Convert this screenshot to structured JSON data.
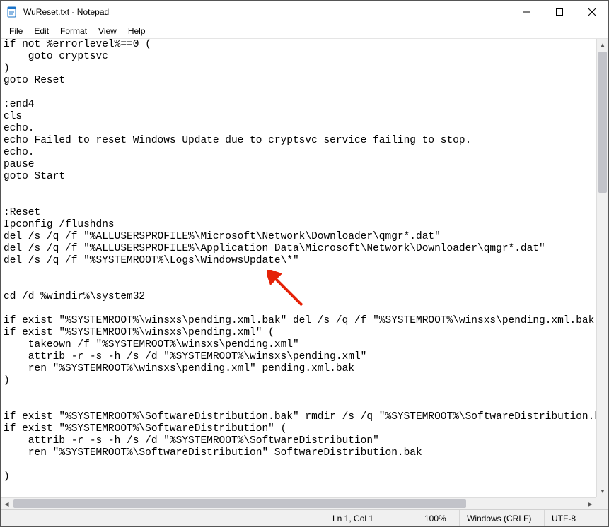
{
  "window": {
    "title": "WuReset.txt - Notepad"
  },
  "menu": {
    "items": [
      "File",
      "Edit",
      "Format",
      "View",
      "Help"
    ]
  },
  "editor": {
    "content": "if not %errorlevel%==0 (\n    goto cryptsvc\n)\ngoto Reset\n\n:end4\ncls\necho.\necho Failed to reset Windows Update due to cryptsvc service failing to stop.\necho.\npause\ngoto Start\n\n\n:Reset\nIpconfig /flushdns\ndel /s /q /f \"%ALLUSERSPROFILE%\\Microsoft\\Network\\Downloader\\qmgr*.dat\"\ndel /s /q /f \"%ALLUSERSPROFILE%\\Application Data\\Microsoft\\Network\\Downloader\\qmgr*.dat\"\ndel /s /q /f \"%SYSTEMROOT%\\Logs\\WindowsUpdate\\*\"\n\n\ncd /d %windir%\\system32\n\nif exist \"%SYSTEMROOT%\\winsxs\\pending.xml.bak\" del /s /q /f \"%SYSTEMROOT%\\winsxs\\pending.xml.bak\"\nif exist \"%SYSTEMROOT%\\winsxs\\pending.xml\" (\n    takeown /f \"%SYSTEMROOT%\\winsxs\\pending.xml\"\n    attrib -r -s -h /s /d \"%SYSTEMROOT%\\winsxs\\pending.xml\"\n    ren \"%SYSTEMROOT%\\winsxs\\pending.xml\" pending.xml.bak\n)\n\n\nif exist \"%SYSTEMROOT%\\SoftwareDistribution.bak\" rmdir /s /q \"%SYSTEMROOT%\\SoftwareDistribution.bak\"\nif exist \"%SYSTEMROOT%\\SoftwareDistribution\" (\n    attrib -r -s -h /s /d \"%SYSTEMROOT%\\SoftwareDistribution\"\n    ren \"%SYSTEMROOT%\\SoftwareDistribution\" SoftwareDistribution.bak\n\n)\n"
  },
  "statusbar": {
    "position": "Ln 1, Col 1",
    "zoom": "100%",
    "line_endings": "Windows (CRLF)",
    "encoding": "UTF-8"
  }
}
